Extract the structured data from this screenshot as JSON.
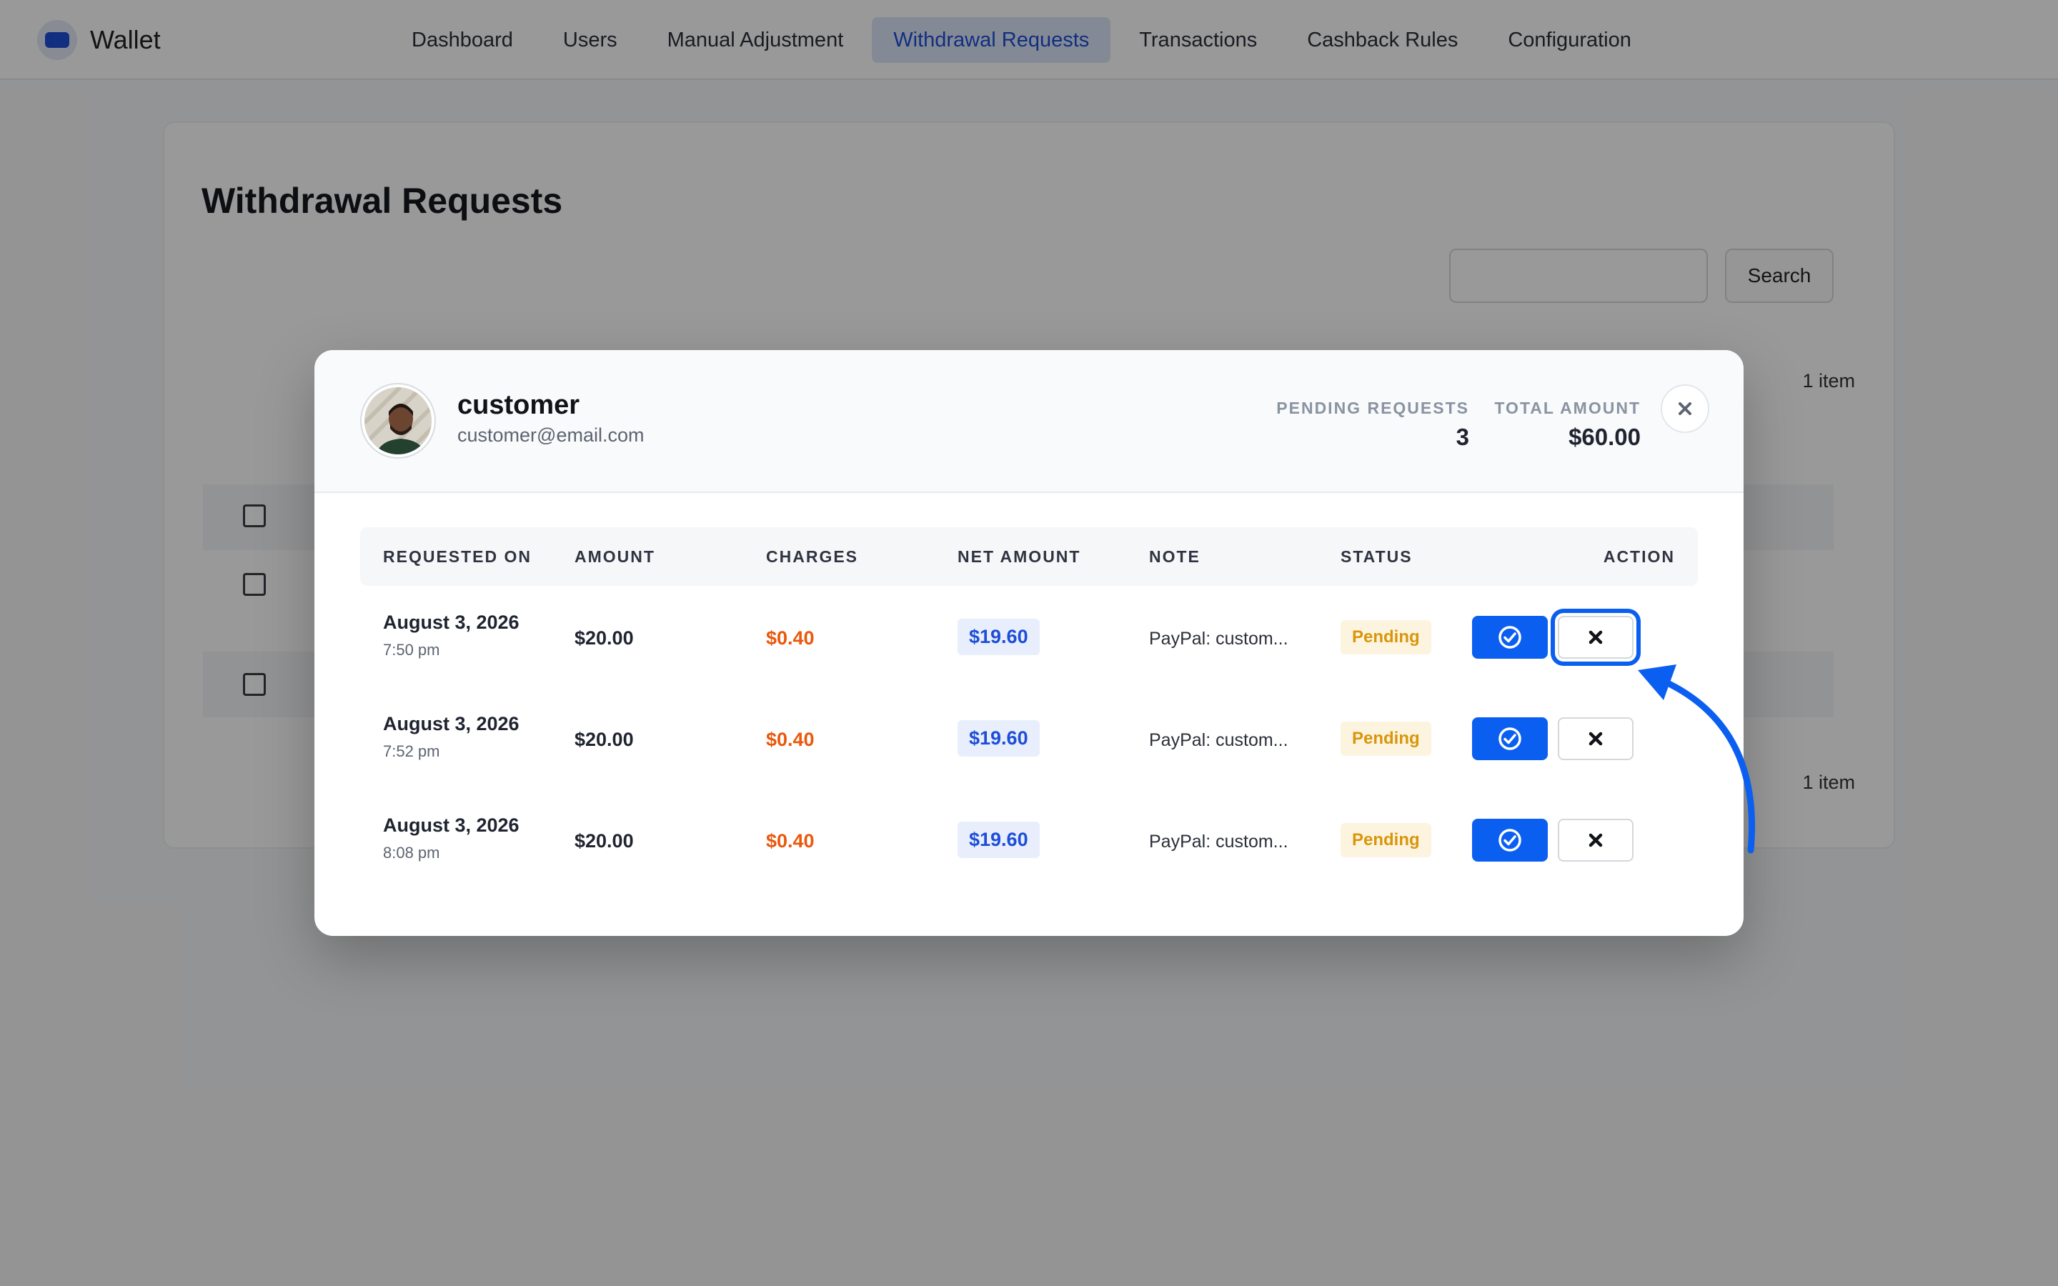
{
  "app": {
    "name": "Wallet",
    "brand_color": "#1d4ed8"
  },
  "nav": {
    "items": [
      {
        "label": "Dashboard"
      },
      {
        "label": "Users"
      },
      {
        "label": "Manual Adjustment"
      },
      {
        "label": "Withdrawal Requests",
        "active": true
      },
      {
        "label": "Transactions"
      },
      {
        "label": "Cashback Rules"
      },
      {
        "label": "Configuration"
      }
    ]
  },
  "page": {
    "title": "Withdrawal Requests",
    "search": {
      "value": "",
      "button_label": "Search"
    },
    "item_count_top": "1 item",
    "item_count_bottom": "1 item"
  },
  "modal": {
    "user": {
      "name": "customer",
      "email": "customer@email.com"
    },
    "stats": {
      "pending_label": "PENDING REQUESTS",
      "pending_value": "3",
      "total_label": "TOTAL AMOUNT",
      "total_value": "$60.00"
    },
    "table": {
      "headers": [
        "REQUESTED ON",
        "AMOUNT",
        "CHARGES",
        "NET AMOUNT",
        "NOTE",
        "STATUS",
        "ACTION"
      ],
      "rows": [
        {
          "date": "August 3, 2026",
          "time": "7:50 pm",
          "amount": "$20.00",
          "charges": "$0.40",
          "net": "$19.60",
          "note": "PayPal: custom...",
          "status": "Pending"
        },
        {
          "date": "August 3, 2026",
          "time": "7:52 pm",
          "amount": "$20.00",
          "charges": "$0.40",
          "net": "$19.60",
          "note": "PayPal: custom...",
          "status": "Pending"
        },
        {
          "date": "August 3, 2026",
          "time": "8:08 pm",
          "amount": "$20.00",
          "charges": "$0.40",
          "net": "$19.60",
          "note": "PayPal: custom...",
          "status": "Pending"
        }
      ]
    },
    "icons": {
      "approve": "check-circle-icon",
      "reject": "x-icon",
      "close": "close-icon"
    }
  },
  "colors": {
    "primary": "#0b5ff0",
    "charges": "#ea580c",
    "pending": "#d9960b",
    "net": "#1d4ed8"
  }
}
